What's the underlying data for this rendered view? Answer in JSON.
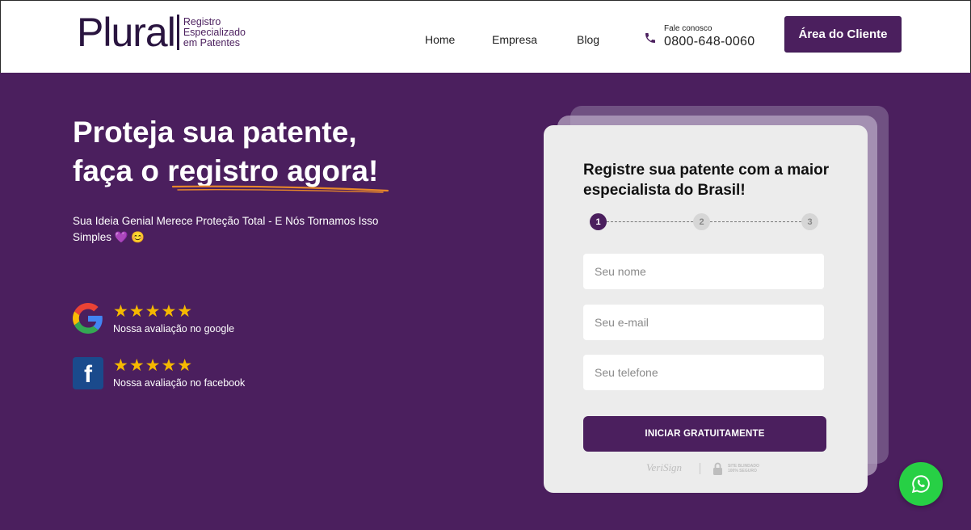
{
  "header": {
    "logo_word": "Plural",
    "logo_sub": [
      "Registro",
      "Especializado",
      "em Patentes"
    ],
    "nav": {
      "home": "Home",
      "empresa": "Empresa",
      "blog": "Blog"
    },
    "contact_label": "Fale conosco",
    "contact_phone": "0800-648-0060",
    "client_button": "Área do Cliente"
  },
  "hero": {
    "title_line1": "Proteja sua patente,",
    "title_line2_a": "faça o ",
    "title_line2_b": "registro agora!",
    "subtitle": "Sua Ideia Genial Merece Proteção Total - E Nós Tornamos Isso Simples 💜 😊",
    "ratings": [
      {
        "stars": "★★★★★",
        "label": "Nossa avaliação no google",
        "icon": "google-icon"
      },
      {
        "stars": "★★★★★",
        "label": "Nossa avaliação no facebook",
        "icon": "facebook-icon"
      }
    ]
  },
  "form": {
    "title": "Registre sua patente com a maior especialista do Brasil!",
    "steps": [
      "1",
      "2",
      "3"
    ],
    "current_step": 1,
    "fields": {
      "name_placeholder": "Seu nome",
      "email_placeholder": "Seu e-mail",
      "phone_placeholder": "Seu telefone"
    },
    "submit": "INICIAR GRATUITAMENTE",
    "seal_verisign": "VeriSign",
    "seal_secure": [
      "SITE BLINDADO",
      "100% SEGURO"
    ]
  },
  "colors": {
    "brand_purple": "#4b1f5e",
    "star_yellow": "#f5b800",
    "underline_orange": "#e8872a",
    "whatsapp_green": "#27d045"
  },
  "floating": {
    "icon": "whatsapp-icon"
  }
}
